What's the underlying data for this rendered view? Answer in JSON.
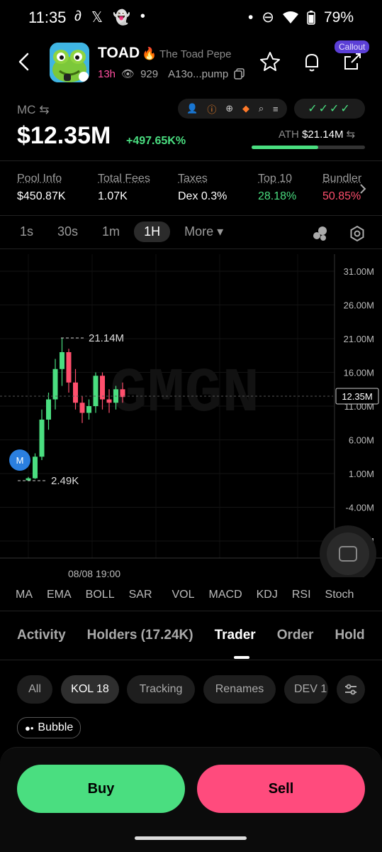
{
  "status": {
    "time": "11:35",
    "battery": "79%"
  },
  "header": {
    "symbol": "TOAD",
    "name": "The Toad Pepe",
    "age": "13h",
    "views": "929",
    "address": "A13o...pump",
    "callout": "Callout"
  },
  "mc": {
    "label": "MC",
    "value": "$12.35M",
    "change": "+497.65K%",
    "ath_label": "ATH",
    "ath_value": "$21.14M",
    "ath_progress": 0.59,
    "checks": "✓✓✓✓"
  },
  "stats": [
    {
      "key": "Pool Info",
      "value": "$450.87K",
      "color": "#ffffff"
    },
    {
      "key": "Total Fees",
      "value": "1.07K",
      "color": "#ffffff"
    },
    {
      "key": "Taxes",
      "value": "Dex 0.3%",
      "color": "#ffffff"
    },
    {
      "key": "Top 10",
      "value": "28.18%",
      "color": "#4ade80"
    },
    {
      "key": "Bundler",
      "value": "50.85%",
      "color": "#ff4f6d"
    }
  ],
  "timeframes": [
    "1s",
    "30s",
    "1m",
    "1H",
    "More ▾"
  ],
  "chart": {
    "y_ticks": [
      "31.00M",
      "26.00M",
      "21.00M",
      "16.00M",
      "11.00M",
      "6.00M",
      "1.00M",
      "-4.00M",
      "-9.00M"
    ],
    "current_price": "12.35M",
    "high_label": "21.14M",
    "low_label": "2.49K",
    "x_label": "08/08 19:00",
    "marker": "M",
    "watermark": "GMGN"
  },
  "indicators": [
    "MA",
    "EMA",
    "BOLL",
    "SAR",
    "VOL",
    "MACD",
    "KDJ",
    "RSI",
    "Stoch"
  ],
  "tabs": [
    "Activity",
    "Holders (17.24K)",
    "Trader",
    "Order",
    "Hold"
  ],
  "filters": [
    "All",
    "KOL 18",
    "Tracking",
    "Renames",
    "DEV 1"
  ],
  "bubble": "Bubble",
  "actions": {
    "buy": "Buy",
    "sell": "Sell"
  },
  "colors": {
    "buy": "#4ade80",
    "sell": "#ff4b7d",
    "up": "#4ade80",
    "down": "#ff4f6d"
  }
}
